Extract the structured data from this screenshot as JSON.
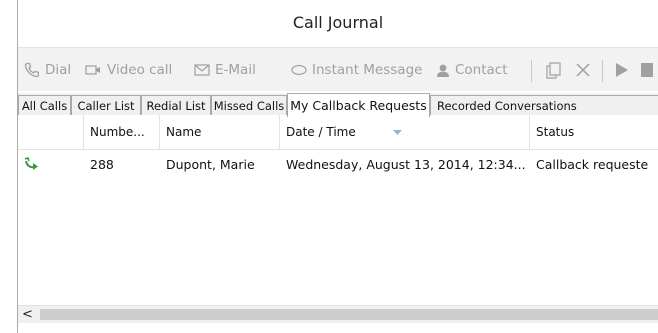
{
  "window": {
    "title": "Call Journal"
  },
  "toolbar": {
    "dial": "Dial",
    "video_call": "Video call",
    "email": "E-Mail",
    "instant_message": "Instant Message",
    "contact": "Contact"
  },
  "tabs": [
    {
      "label": "All Calls"
    },
    {
      "label": "Caller List"
    },
    {
      "label": "Redial List"
    },
    {
      "label": "Missed Calls"
    },
    {
      "label": "My Callback Requests",
      "active": true
    },
    {
      "label": "Recorded Conversations"
    }
  ],
  "table": {
    "columns": [
      "Numbe...",
      "Name",
      "Date / Time",
      "Status"
    ],
    "rows": [
      {
        "icon": "callback-arrow-icon",
        "number": "288",
        "name": "Dupont, Marie",
        "datetime": "Wednesday, August 13, 2014, 12:34...",
        "status": "Callback requeste"
      }
    ]
  },
  "scrollbar": {
    "left_arrow": "<"
  },
  "colors": {
    "icon_green": "#3a9a3a",
    "disabled": "#a0a0a0",
    "toolbar_bg": "#f2f2f2"
  }
}
